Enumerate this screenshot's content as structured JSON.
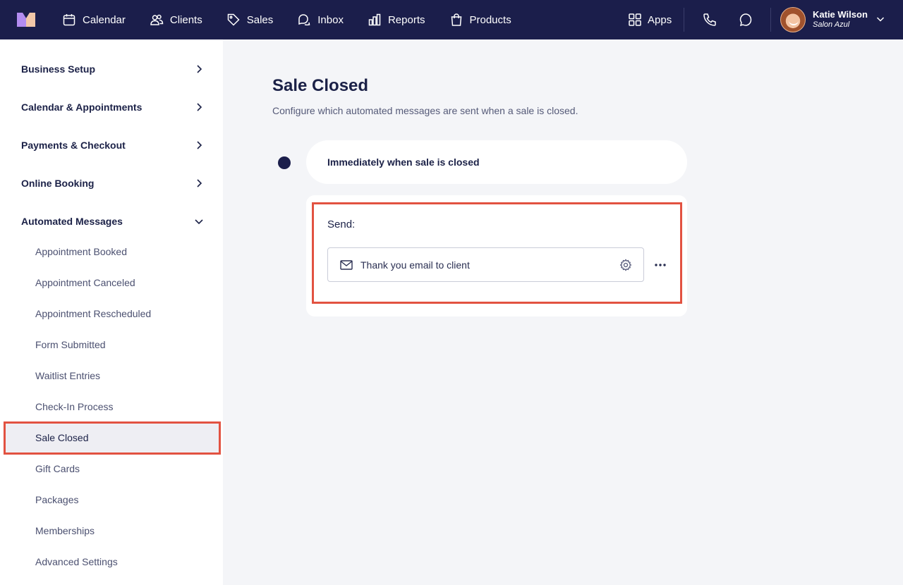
{
  "nav": {
    "items": [
      {
        "label": "Calendar",
        "icon": "calendar-icon"
      },
      {
        "label": "Clients",
        "icon": "users-icon"
      },
      {
        "label": "Sales",
        "icon": "tag-icon"
      },
      {
        "label": "Inbox",
        "icon": "chat-bubbles-icon"
      },
      {
        "label": "Reports",
        "icon": "bar-chart-icon"
      },
      {
        "label": "Products",
        "icon": "shopping-bag-icon"
      }
    ],
    "apps_label": "Apps",
    "user": {
      "name": "Katie Wilson",
      "salon": "Salon Azul"
    }
  },
  "sidebar": {
    "sections": [
      {
        "label": "Business Setup",
        "expanded": false
      },
      {
        "label": "Calendar & Appointments",
        "expanded": false
      },
      {
        "label": "Payments & Checkout",
        "expanded": false
      },
      {
        "label": "Online Booking",
        "expanded": false
      },
      {
        "label": "Automated Messages",
        "expanded": true
      }
    ],
    "sub_items": [
      {
        "label": "Appointment Booked"
      },
      {
        "label": "Appointment Canceled"
      },
      {
        "label": "Appointment Rescheduled"
      },
      {
        "label": "Form Submitted"
      },
      {
        "label": "Waitlist Entries"
      },
      {
        "label": "Check-In Process"
      },
      {
        "label": "Sale Closed",
        "active": true
      },
      {
        "label": "Gift Cards"
      },
      {
        "label": "Packages"
      },
      {
        "label": "Memberships"
      },
      {
        "label": "Advanced Settings"
      }
    ]
  },
  "main": {
    "title": "Sale Closed",
    "description": "Configure which automated messages are sent when a sale is closed.",
    "trigger_label": "Immediately when sale is closed",
    "send_label": "Send:",
    "message_label": "Thank you email to client"
  },
  "colors": {
    "nav_bg": "#1b1e4b",
    "highlight": "#e25241",
    "page_bg": "#f4f5f8"
  }
}
